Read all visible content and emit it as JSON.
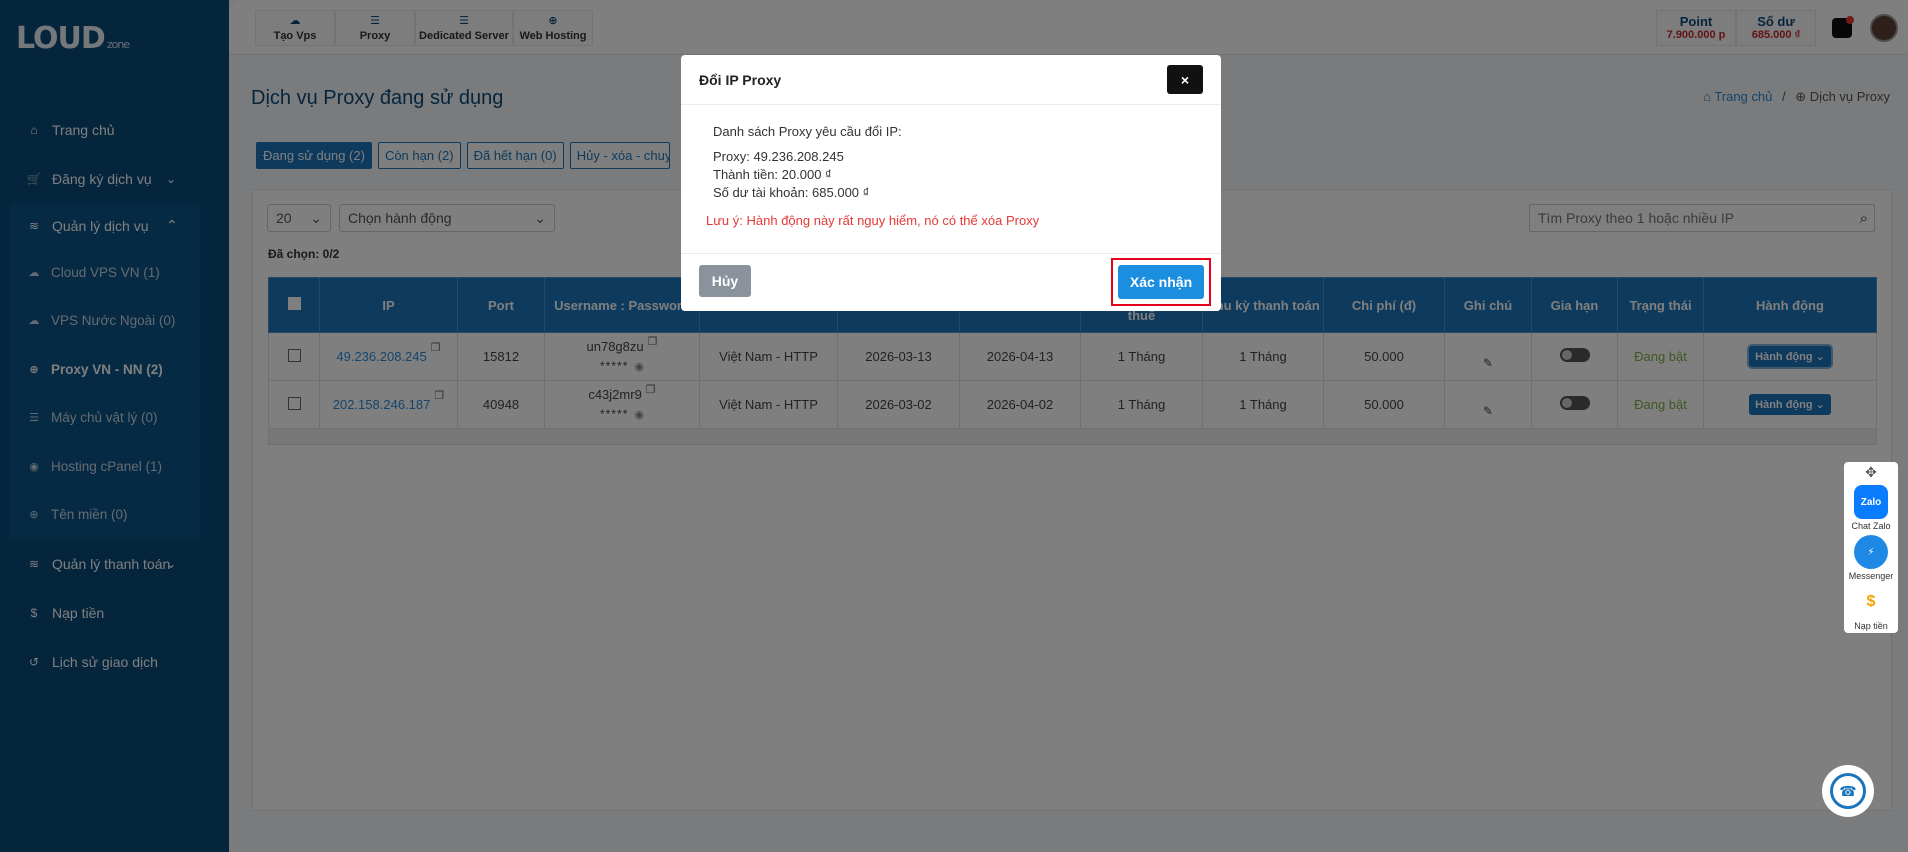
{
  "brand": {
    "logo_text": "LOUD",
    "logo_sub": "zone"
  },
  "sidebar": {
    "items": [
      {
        "label": "Trang chủ",
        "icon": "dashboard-icon"
      },
      {
        "label": "Đăng ký dịch vụ",
        "icon": "cart-icon"
      }
    ],
    "group": {
      "label": "Quản lý dịch vụ",
      "icon": "layers-icon",
      "children": [
        {
          "label": "Cloud VPS VN (1)"
        },
        {
          "label": "VPS Nước Ngoài (0)"
        },
        {
          "label": "Proxy VN - NN (2)"
        },
        {
          "label": "Máy chủ vật lý (0)"
        },
        {
          "label": "Hosting cPanel (1)"
        },
        {
          "label": "Tên miền (0)"
        }
      ]
    },
    "after": [
      {
        "label": "Quản lý thanh toán"
      },
      {
        "label": "Nạp tiền"
      },
      {
        "label": "Lịch sử giao dịch"
      }
    ]
  },
  "topbar": {
    "tabs": [
      {
        "label": "Tạo Vps"
      },
      {
        "label": "Proxy"
      },
      {
        "label": "Dedicated Server"
      },
      {
        "label": "Web Hosting"
      }
    ],
    "point_label": "Point",
    "point_value": "7.900.000 p",
    "balance_label": "Số dư",
    "balance_value": "685.000 ₫"
  },
  "page": {
    "title": "Dịch vụ Proxy đang sử dụng",
    "breadcrumb_home": "Trang chủ",
    "breadcrumb_sep": "/",
    "breadcrumb_current": "Dịch vụ Proxy",
    "filters": [
      "Đang sử dụng (2)",
      "Còn hạn (2)",
      "Đã hết hạn (0)",
      "Hủy - xóa - chuyển"
    ],
    "page_size": "20",
    "action_select": "Chọn hành động",
    "search_placeholder": "Tìm Proxy theo 1 hoặc nhiều IP",
    "selected_count": "Đã chọn: 0/2"
  },
  "table": {
    "headers": [
      "IP",
      "Port",
      "Username : Password",
      "",
      "",
      "",
      "thuê",
      "Chu kỳ thanh toán",
      "Chi phí (đ)",
      "Ghi chú",
      "Gia hạn",
      "Trạng thái",
      "Hành động"
    ],
    "rows": [
      {
        "ip": "49.236.208.245",
        "port": "15812",
        "user": "un78g8zu",
        "pw": "*****",
        "type": "Việt Nam - HTTP",
        "start": "2026-03-13",
        "end": "2026-04-13",
        "term": "1 Tháng",
        "cycle": "1 Tháng",
        "cost": "50.000",
        "status": "Đang bật",
        "action": "Hành động ⌄"
      },
      {
        "ip": "202.158.246.187",
        "port": "40948",
        "user": "c43j2mr9",
        "pw": "*****",
        "type": "Việt Nam - HTTP",
        "start": "2026-03-02",
        "end": "2026-04-02",
        "term": "1 Tháng",
        "cycle": "1 Tháng",
        "cost": "50.000",
        "status": "Đang bật",
        "action": "Hành động ⌄"
      }
    ]
  },
  "modal": {
    "title": "Đổi IP Proxy",
    "close": "×",
    "intro": "Danh sách Proxy yêu cầu đổi IP:",
    "proxy_line": "Proxy: 49.236.208.245",
    "cost_line": "Thành tiền: 20.000 ₫",
    "balance_line": "Số dư tài khoản: 685.000 ₫",
    "warning": "Lưu ý: Hành động này rất nguy hiểm, nó có thể xóa Proxy",
    "cancel": "Hủy",
    "confirm": "Xác nhận"
  },
  "widgets": {
    "zalo_icon": "Zalo",
    "zalo": "Chat Zalo",
    "messenger": "Messenger",
    "topup": "Nạp tiền"
  },
  "colors": {
    "sidebar": "#0b4a7a",
    "primary": "#1b75bb",
    "danger": "#e53935",
    "confirm": "#1b8ee0"
  }
}
